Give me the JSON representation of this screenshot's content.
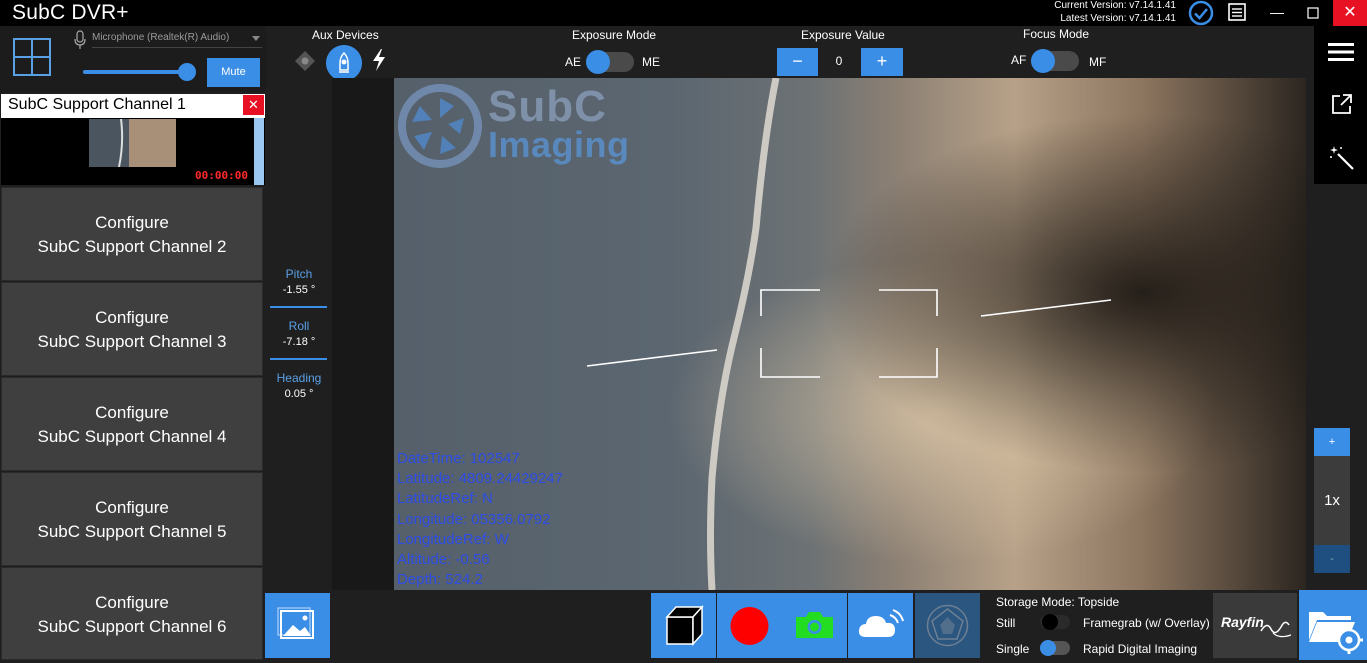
{
  "window": {
    "title": "SubC DVR+",
    "current_version": "Current Version: v7.14.1.41",
    "latest_version": "Latest Version: v7.14.1.41",
    "minimize": "—",
    "close": "✕"
  },
  "audio": {
    "device": "Microphone (Realtek(R) Audio)",
    "volume_fraction": 0.95,
    "mute_label": "Mute"
  },
  "aux_devices": {
    "label": "Aux Devices"
  },
  "exposure_mode": {
    "label": "Exposure Mode",
    "left": "AE",
    "right": "ME",
    "value": "AE"
  },
  "exposure_value": {
    "label": "Exposure Value",
    "minus": "−",
    "value": "0",
    "plus": "+"
  },
  "focus_mode": {
    "label": "Focus Mode",
    "left": "AF",
    "right": "MF",
    "value": "AF"
  },
  "channels": {
    "active": {
      "title": "SubC Support Channel 1",
      "close": "✕",
      "timer": "00:00:00"
    },
    "configure": [
      {
        "line1": "Configure",
        "line2": "SubC Support Channel 2"
      },
      {
        "line1": "Configure",
        "line2": "SubC Support Channel 3"
      },
      {
        "line1": "Configure",
        "line2": "SubC Support Channel 4"
      },
      {
        "line1": "Configure",
        "line2": "SubC Support Channel 5"
      },
      {
        "line1": "Configure",
        "line2": "SubC Support Channel 6"
      }
    ]
  },
  "sensors": {
    "pitch": {
      "label": "Pitch",
      "value": "-1.55 °"
    },
    "roll": {
      "label": "Roll",
      "value": "-7.18 °"
    },
    "heading": {
      "label": "Heading",
      "value": "0.05 °"
    }
  },
  "video": {
    "logo_line1": "SubC",
    "logo_line2": "Imaging",
    "overlay": [
      "DateTime: 102547",
      "Latitude: 4809.24429247",
      "LatitudeRef: N",
      "Longitude: 05356.0792",
      "LongitudeRef: W",
      "Altitude: -0.56",
      "Depth: 524.2"
    ]
  },
  "zoom": {
    "plus": "+",
    "level": "1x",
    "minus": "-"
  },
  "capture": {
    "storage_mode": "Storage Mode: Topside",
    "still_label": "Still",
    "framegrab_label": "Framegrab (w/ Overlay)",
    "single_label": "Single",
    "rdi_label": "Rapid Digital Imaging",
    "still_framegrab_on": false,
    "single_rdi_on": true,
    "brand": "Rayfin"
  },
  "colors": {
    "accent": "#3a8ee6",
    "close_red": "#e81123",
    "overlay_text": "#2d4de6",
    "camera_icon": "#22dd22",
    "record_dot": "#ff0000"
  }
}
